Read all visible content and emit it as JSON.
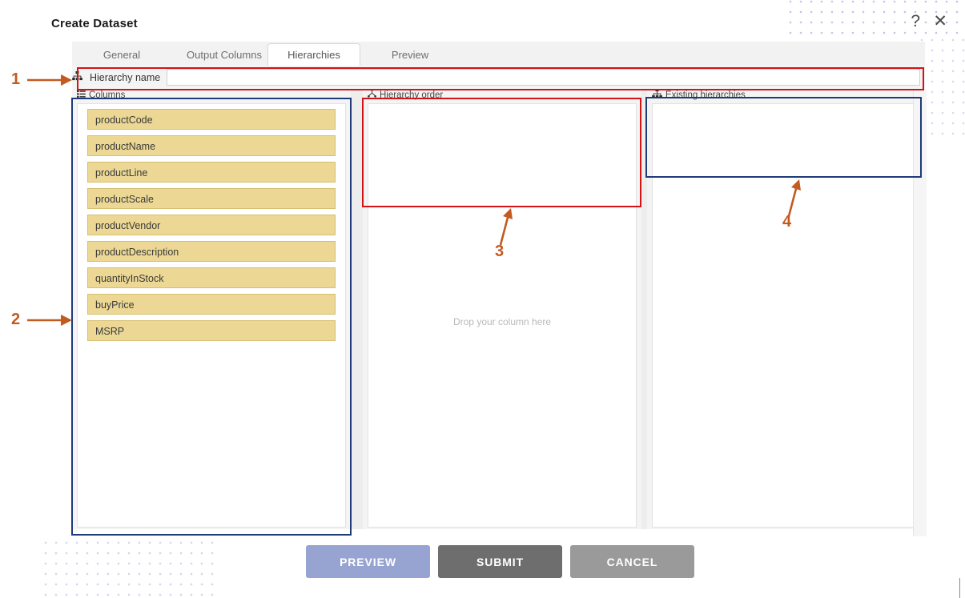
{
  "window": {
    "title": "Create Dataset",
    "help_icon": "question-mark-icon",
    "close_icon": "close-x-icon",
    "help_glyph": "?",
    "close_glyph": "✕"
  },
  "tabs": [
    {
      "label": "General",
      "active": false
    },
    {
      "label": "Output Columns",
      "active": false
    },
    {
      "label": "Hierarchies",
      "active": true
    },
    {
      "label": "Preview",
      "active": false
    }
  ],
  "hierarchy_name": {
    "label": "Hierarchy name",
    "value": "",
    "placeholder": "",
    "icon": "sitemap-icon"
  },
  "panels": {
    "columns": {
      "title": "Columns",
      "icon": "list-grid-icon",
      "items": [
        "productCode",
        "productName",
        "productLine",
        "productScale",
        "productVendor",
        "productDescription",
        "quantityInStock",
        "buyPrice",
        "MSRP"
      ]
    },
    "hierarchy_order": {
      "title": "Hierarchy order",
      "icon": "hierarchy-icon",
      "items": [],
      "drop_hint": "Drop your column here"
    },
    "existing_hierarchies": {
      "title": "Existing hierarchies",
      "icon": "sitemap-icon",
      "items": []
    }
  },
  "footer": {
    "preview_label": "PREVIEW",
    "submit_label": "SUBMIT",
    "cancel_label": "CANCEL"
  },
  "annotations": [
    {
      "number": "1",
      "target": "hierarchy-name-row",
      "highlight": "red"
    },
    {
      "number": "2",
      "target": "columns-panel",
      "highlight": "navy"
    },
    {
      "number": "3",
      "target": "hierarchy-order-panel",
      "highlight": "red"
    },
    {
      "number": "4",
      "target": "existing-hierarchies-panel",
      "highlight": "navy"
    }
  ],
  "colors": {
    "highlight_red": "#d31414",
    "highlight_navy": "#1f3a78",
    "annotation_orange": "#c35a20",
    "column_chip": "#ecd894",
    "preview_button": "#97a3d1",
    "submit_button": "#6e6e6e",
    "cancel_button": "#9a9a9a"
  }
}
